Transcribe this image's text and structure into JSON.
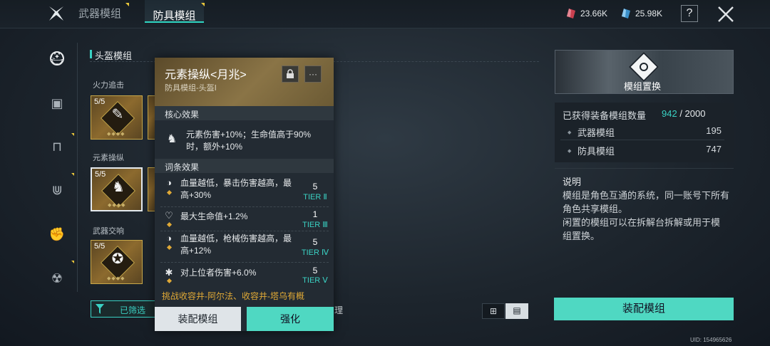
{
  "tabs": [
    {
      "label": "武器模组",
      "selected": false
    },
    {
      "label": "防具模组",
      "selected": true
    }
  ],
  "resources": [
    {
      "icon": "red-crystal-icon",
      "value": "23.66K",
      "color": "#d94b5a"
    },
    {
      "icon": "blue-crystal-icon",
      "value": "25.98K",
      "color": "#4aa8e0"
    }
  ],
  "topbar": {
    "help_label": "?"
  },
  "category": {
    "title": "头盔模组"
  },
  "sections": [
    {
      "label": "火力追击",
      "count": "5/5"
    },
    {
      "label": "元素操纵",
      "count": "5/5"
    },
    {
      "label": "武器交响",
      "count": "5/5"
    }
  ],
  "filter": {
    "label": "已筛选",
    "partial_text": "理"
  },
  "popup": {
    "title": "元素操纵<月兆>",
    "subtitle": "防具模组-头盔Ⅰ",
    "core_header": "核心效果",
    "core_text": "元素伤害+10%；生命值高于90%时，额外+10%",
    "affix_header": "词条效果",
    "affixes": [
      {
        "text": "血量越低，暴击伤害越高，最高+30%",
        "level": "5",
        "tier": "TIER Ⅱ",
        "icon": "crit-icon"
      },
      {
        "text": "最大生命值+1.2%",
        "level": "1",
        "tier": "TIER Ⅲ",
        "icon": "heart-icon"
      },
      {
        "text": "血量越低，枪械伤害越高，最高+12%",
        "level": "5",
        "tier": "TIER Ⅳ",
        "icon": "gun-icon"
      },
      {
        "text": "对上位者伤害+6.0%",
        "level": "5",
        "tier": "TIER Ⅴ",
        "icon": "boss-icon"
      }
    ],
    "source": "挑战收容井-阿尔法、收容井-塔乌有概",
    "equip_label": "装配模组",
    "enhance_label": "强化",
    "more_label": "···"
  },
  "right": {
    "banner_label": "模组置换",
    "obtained_label": "已获得装备模组数量",
    "obtained_current": "942",
    "obtained_sep": " / ",
    "obtained_max": "2000",
    "rows": [
      {
        "label": "武器模组",
        "value": "195"
      },
      {
        "label": "防具模组",
        "value": "747"
      }
    ],
    "desc_title": "说明",
    "desc_lines": [
      "模组是角色互通的系统，同一账号下所有",
      "角色共享模组。",
      "闲置的模组可以在拆解台拆解或用于模",
      "组置换。"
    ],
    "equip_label": "装配模组"
  },
  "uid": "UID: 154965626",
  "colors": {
    "accent": "#4fd8c2",
    "tier": "#3ad1c3",
    "gold": "#c8a84a",
    "obtained": "#3ad1c3"
  }
}
